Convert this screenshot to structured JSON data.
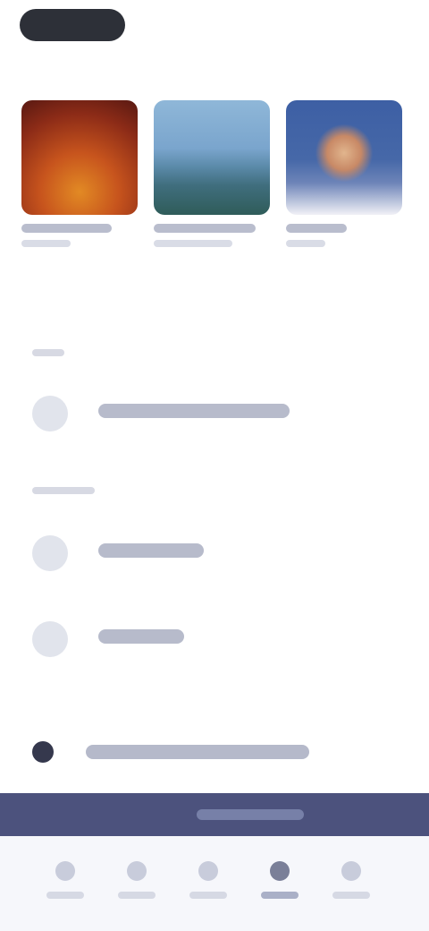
{
  "app": {
    "title": ""
  },
  "header": {
    "pill_label": ""
  },
  "featured": {
    "cards": [
      {
        "title": "",
        "subtitle": "",
        "image": "orange-abstract-image"
      },
      {
        "title": "",
        "subtitle": "",
        "image": "landscape-image"
      },
      {
        "title": "",
        "subtitle": "",
        "image": "portrait-image"
      }
    ]
  },
  "sections": [
    {
      "label": "",
      "items": [
        {
          "label": "",
          "icon": "user-icon"
        }
      ]
    },
    {
      "label": "",
      "items": [
        {
          "label": "",
          "icon": "bookmark-icon"
        },
        {
          "label": "",
          "icon": "settings-icon"
        }
      ]
    }
  ],
  "promo": {
    "label": "",
    "icon": "info-icon"
  },
  "toolbar": {
    "label": ""
  },
  "bottom_nav": {
    "items": [
      {
        "label": "",
        "icon": "home-icon"
      },
      {
        "label": "",
        "icon": "explore-icon"
      },
      {
        "label": "",
        "icon": "library-icon"
      },
      {
        "label": "",
        "icon": "messages-icon"
      },
      {
        "label": "",
        "icon": "profile-icon"
      }
    ],
    "active_index": 3
  },
  "colors": {
    "toolbar": "#4c527d",
    "bottom_nav_bg": "#f6f7fb",
    "dark_pill": "#2d3038"
  }
}
